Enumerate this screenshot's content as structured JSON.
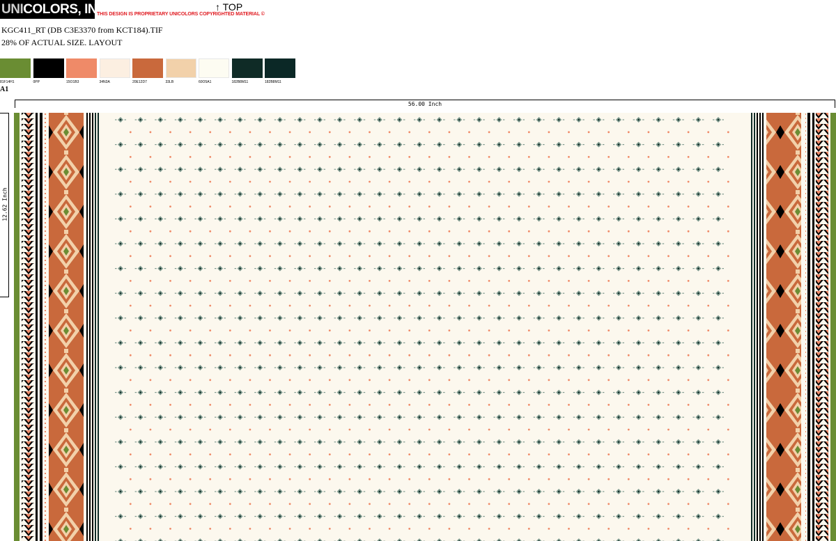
{
  "header": {
    "logo_prefix": "UNI",
    "logo_suffix": "COLORS, INC.",
    "notice_1": "THIS DESIGN IS PROPRIETARY ",
    "notice_2": "UNI",
    "notice_3": "COLORS",
    "notice_4": " COPYRIGHTED MATERIAL ©",
    "top_label": "↑ TOP",
    "filename": "KGC411_RT (DB C3E3370 from KCT184).TIF",
    "scale": "28% OF ACTUAL SIZE. LAYOUT"
  },
  "swatches": [
    {
      "code": "81F14H1",
      "color": "#6a8d33"
    },
    {
      "code": "0PP",
      "color": "#000000"
    },
    {
      "code": "15O1B3",
      "color": "#ef8a68"
    },
    {
      "code": "34N3A",
      "color": "#fcefe1"
    },
    {
      "code": "20E12D7",
      "color": "#c9693c"
    },
    {
      "code": "33LB",
      "color": "#f2d1aa"
    },
    {
      "code": "60O5A1",
      "color": "#fdfcf2"
    },
    {
      "code": "182B8M11",
      "color": "#0f2b26"
    },
    {
      "code": "182B8M11",
      "color": "#0b2826"
    }
  ],
  "group_label": "A1",
  "dimensions": {
    "width": "56.00 Inch",
    "height": "12.62 Inch"
  },
  "fabric_colors": {
    "ground": "#fcf8ee",
    "green": "#6a8d33",
    "rust": "#c9693c",
    "peach": "#f2d1aa",
    "coral": "#ef8a68",
    "teal": "#0f2b26",
    "motif": "#7f9a8f"
  }
}
